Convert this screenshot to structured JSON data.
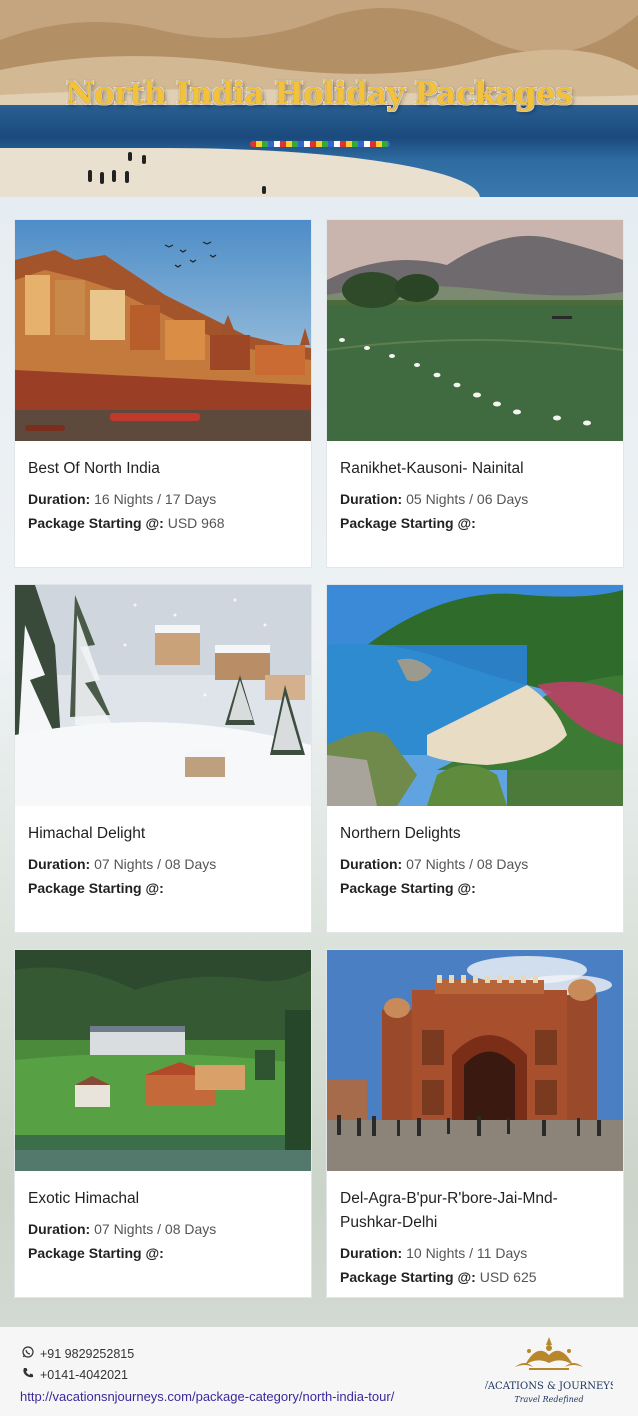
{
  "header": {
    "title": "North India Holiday Packages"
  },
  "cards": [
    {
      "title": "Best Of North India",
      "duration_label": "Duration:",
      "duration": "16 Nights / 17 Days",
      "price_label": "Package Starting @:",
      "price": "USD 968"
    },
    {
      "title": "Ranikhet-Kausoni- Nainital",
      "duration_label": "Duration:",
      "duration": "05 Nights / 06 Days",
      "price_label": "Package Starting @:",
      "price": ""
    },
    {
      "title": "Himachal Delight",
      "duration_label": "Duration:",
      "duration": "07 Nights / 08 Days",
      "price_label": "Package Starting @:",
      "price": ""
    },
    {
      "title": "Northern Delights",
      "duration_label": "Duration:",
      "duration": "07 Nights / 08 Days",
      "price_label": "Package Starting @:",
      "price": ""
    },
    {
      "title": "Exotic Himachal",
      "duration_label": "Duration:",
      "duration": "07 Nights / 08 Days",
      "price_label": "Package Starting @:",
      "price": ""
    },
    {
      "title": "Del-Agra-B'pur-R'bore-Jai-Mnd-Pushkar-Delhi",
      "duration_label": "Duration:",
      "duration": "10 Nights / 11 Days",
      "price_label": "Package Starting @:",
      "price": "USD 625"
    }
  ],
  "footer": {
    "whatsapp": "+91 9829252815",
    "phone": "+0141-4042021",
    "url": "http://vacationsnjourneys.com/package-category/north-india-tour/",
    "logo_text": "VACATIONS & JOURNEYS",
    "logo_tagline": "Travel Redefined",
    "whatsapp_icon": "whatsapp-icon",
    "phone_icon": "phone-icon"
  },
  "colors": {
    "title_gold": "#f3c13a",
    "link": "#3a2a9a",
    "logo_gold": "#b8862b"
  }
}
